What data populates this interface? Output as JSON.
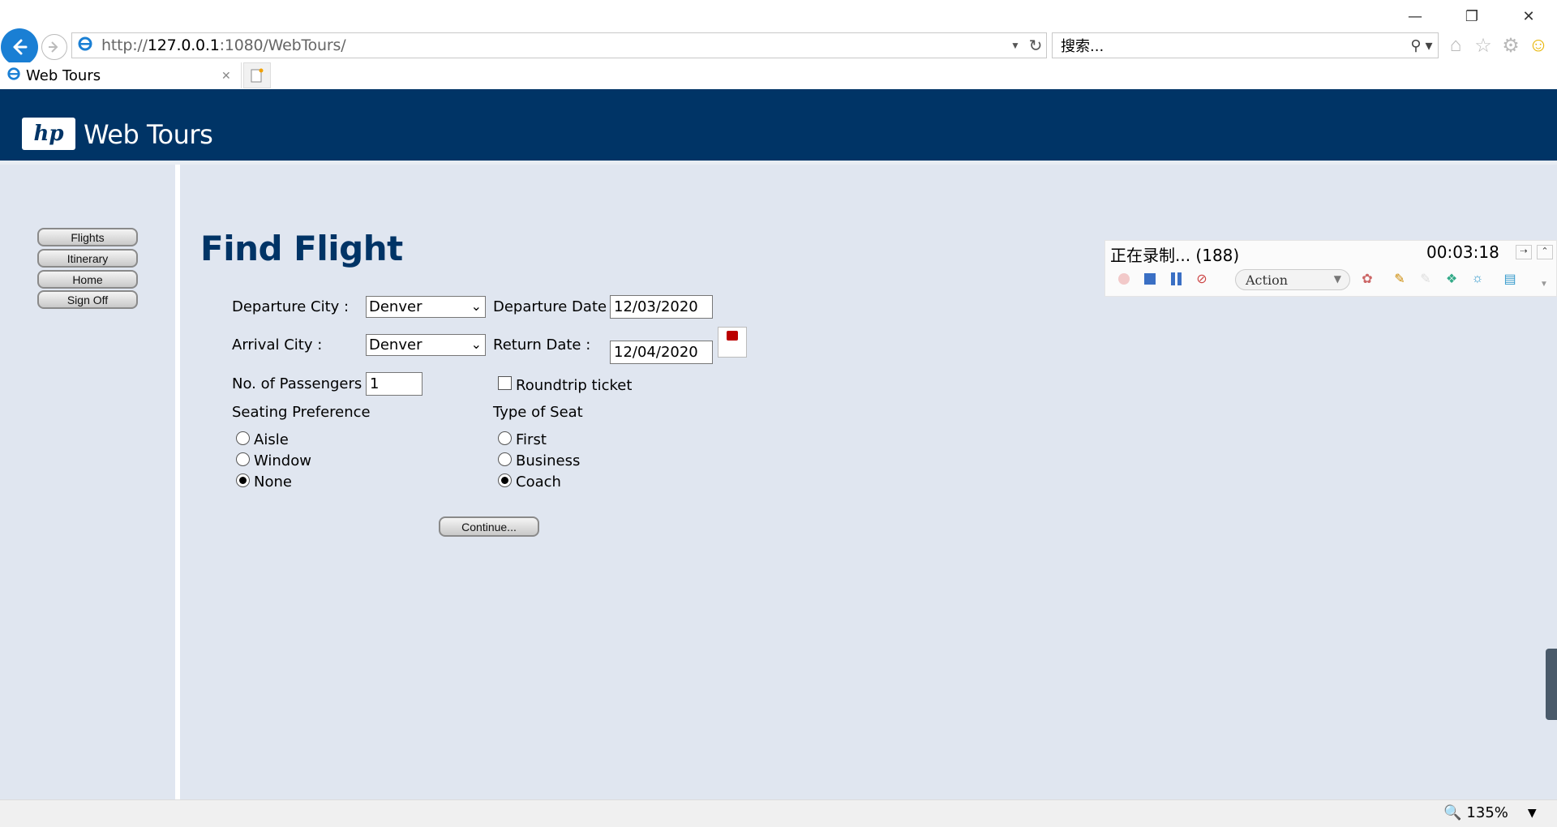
{
  "browser": {
    "url_prefix": "http://",
    "url_host": "127.0.0.1",
    "url_rest": ":1080/WebTours/",
    "search_placeholder": "搜索...",
    "tab_title": "Web Tours",
    "zoom": "135%"
  },
  "site": {
    "logo_text": "hp",
    "brand": "Web Tours"
  },
  "nav": {
    "items": [
      {
        "label": "Flights"
      },
      {
        "label": "Itinerary"
      },
      {
        "label": "Home"
      },
      {
        "label": "Sign Off"
      }
    ]
  },
  "form": {
    "title": "Find Flight",
    "departure_city_label": "Departure City :",
    "departure_city_value": "Denver",
    "departure_date_label": "Departure Date :",
    "departure_date_value": "12/03/2020",
    "arrival_city_label": "Arrival City :",
    "arrival_city_value": "Denver",
    "return_date_label": "Return Date :",
    "return_date_value": "12/04/2020",
    "passengers_label": "No. of Passengers :",
    "passengers_value": "1",
    "roundtrip_label": "Roundtrip ticket",
    "roundtrip_checked": false,
    "seating_pref_label": "Seating Preference",
    "seating_options": [
      {
        "label": "Aisle",
        "selected": false
      },
      {
        "label": "Window",
        "selected": false
      },
      {
        "label": "None",
        "selected": true
      }
    ],
    "seat_type_label": "Type of Seat",
    "seat_types": [
      {
        "label": "First",
        "selected": false
      },
      {
        "label": "Business",
        "selected": false
      },
      {
        "label": "Coach",
        "selected": true
      }
    ],
    "continue_label": "Continue..."
  },
  "recorder": {
    "status": "正在录制... (188)",
    "elapsed": "00:03:18",
    "action_select": "Action"
  },
  "colors": {
    "banner": "#003466",
    "page_bg": "#e0e6f0",
    "title": "#003466"
  }
}
